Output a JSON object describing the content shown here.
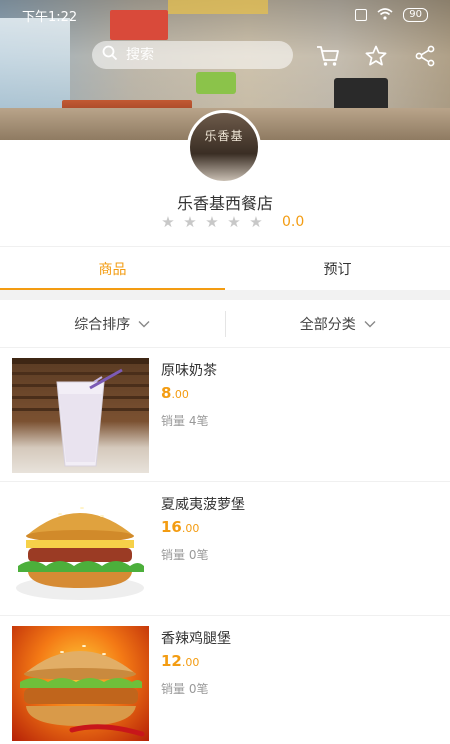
{
  "status_bar": {
    "time": "下午1:22",
    "battery": "90"
  },
  "search": {
    "placeholder": "搜索"
  },
  "shop": {
    "name": "乐香基西餐店",
    "rating": "0.0",
    "stars_filled": 0,
    "stars_total": 5,
    "avatar_text": "乐香基"
  },
  "tabs": [
    {
      "label": "商品",
      "active": true
    },
    {
      "label": "预订",
      "active": false
    }
  ],
  "filters": {
    "sort_label": "综合排序",
    "category_label": "全部分类"
  },
  "products": [
    {
      "name": "原味奶茶",
      "price_int": "8",
      "price_dec": ".00",
      "sales": "销量 4笔"
    },
    {
      "name": "夏威夷菠萝堡",
      "price_int": "16",
      "price_dec": ".00",
      "sales": "销量 0笔"
    },
    {
      "name": "香辣鸡腿堡",
      "price_int": "12",
      "price_dec": ".00",
      "sales": "销量 0笔"
    }
  ],
  "colors": {
    "accent": "#f39c12",
    "star_empty": "#c8c8c8"
  },
  "icons": {
    "search": "search-icon",
    "cart": "cart-icon",
    "favorite": "star-outline-icon",
    "share": "share-icon",
    "chevron": "chevron-down-icon"
  }
}
